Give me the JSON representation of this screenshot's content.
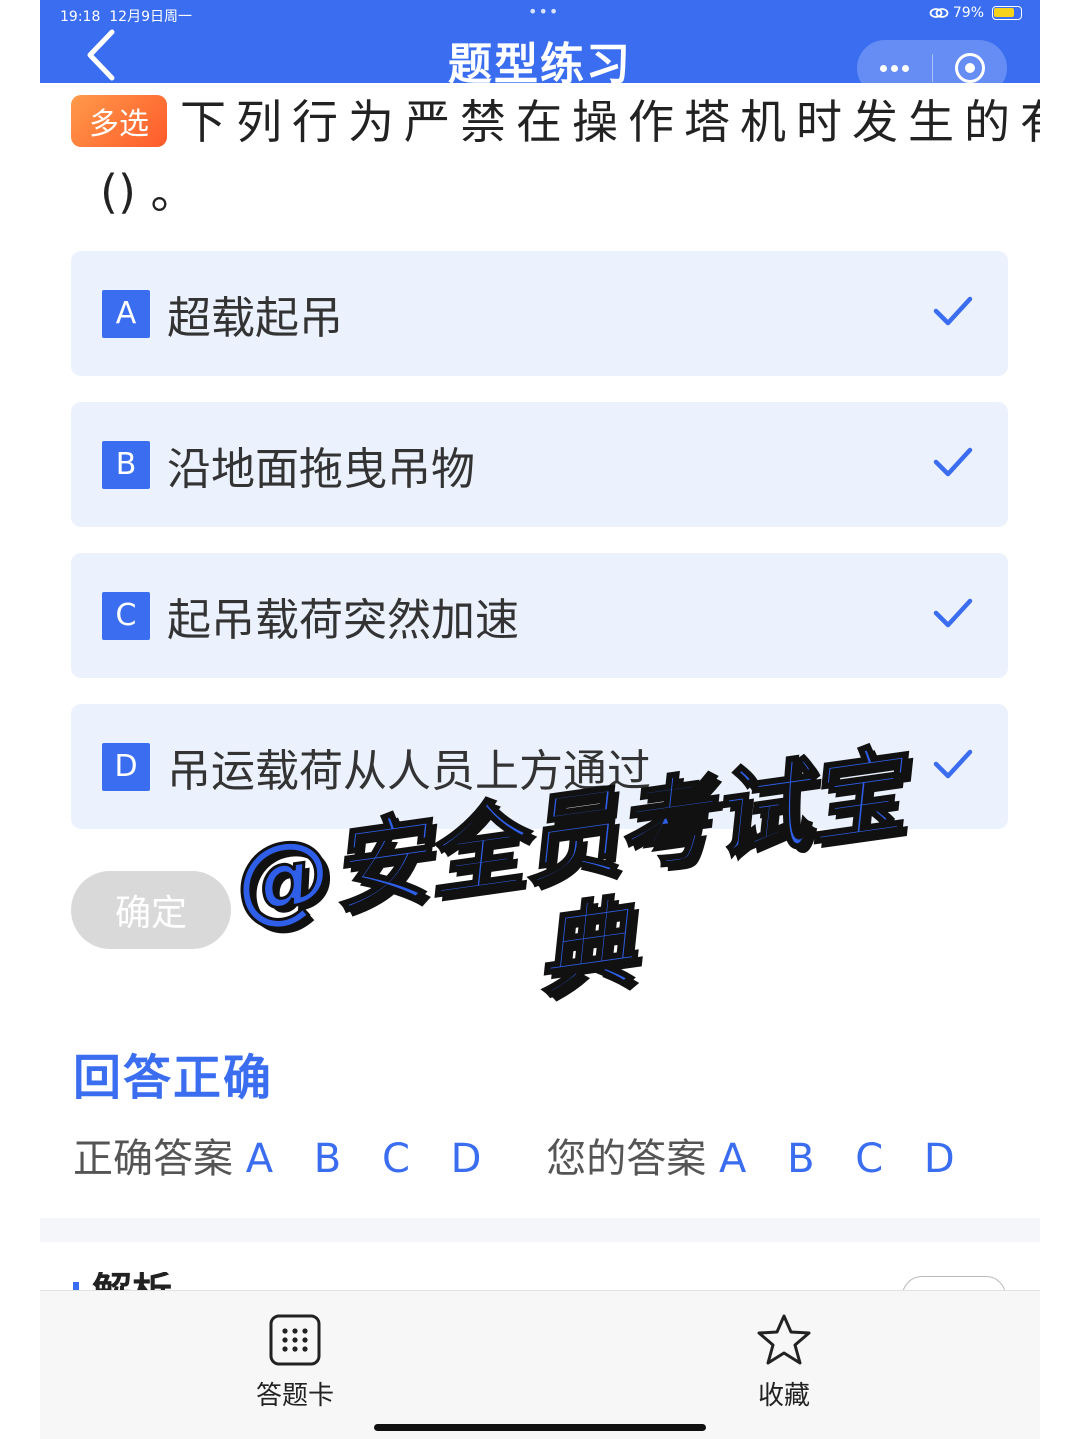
{
  "status_bar": {
    "time": "19:18",
    "date": "12月9日周一",
    "dots": "•••",
    "battery_text": "79%",
    "battery_level": 0.79,
    "battery_color": "#f7d21b"
  },
  "header": {
    "title": "题型练习",
    "back_icon": "chevron-left-icon",
    "more_icon": "more-dots-icon",
    "target_icon": "target-icon"
  },
  "question": {
    "type_badge": "多选",
    "text_line1": "下列行为严禁在操作塔机时发生的有",
    "text_line2": "()  。"
  },
  "options": [
    {
      "letter": "A",
      "text": "超载起吊",
      "selected": true
    },
    {
      "letter": "B",
      "text": "沿地面拖曳吊物",
      "selected": true
    },
    {
      "letter": "C",
      "text": "起吊载荷突然加速",
      "selected": true
    },
    {
      "letter": "D",
      "text": "吊运载荷从人员上方通过",
      "selected": true
    }
  ],
  "confirm_label": "确定",
  "watermark": {
    "line1": "@安全员考试宝",
    "line2": "典"
  },
  "result": {
    "status": "回答正确",
    "correct_label": "正确答案",
    "correct_value": "A B C D",
    "your_label": "您的答案",
    "your_value": "A B C D"
  },
  "analysis": {
    "title": "解析"
  },
  "bottom_tabs": [
    {
      "label": "答题卡",
      "icon": "answer-card-grid-icon"
    },
    {
      "label": "收藏",
      "icon": "star-icon"
    }
  ],
  "colors": {
    "accent": "#3a6df0",
    "option_bg": "#ebf1fd",
    "badge_gradient_start": "#ff9a4a",
    "badge_gradient_end": "#ff5a2a"
  }
}
